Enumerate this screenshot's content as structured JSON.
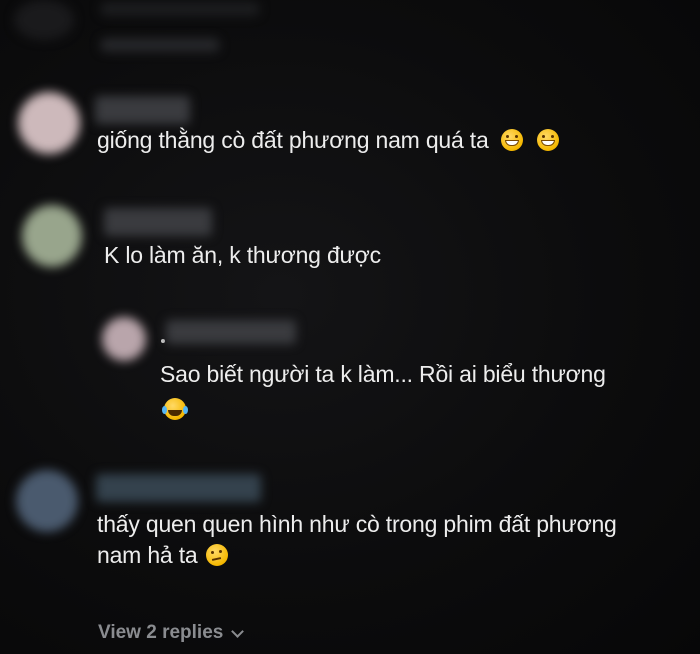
{
  "comments": [
    {
      "text": "giống thằng cò đất phương nam quá ta",
      "emojis": [
        "grinning-icon",
        "grinning-icon"
      ]
    },
    {
      "text": "K lo làm ăn, k thương được",
      "emojis": []
    },
    {
      "is_reply": true,
      "line1": "Sao biết người ta k làm... Rồi ai biểu thương",
      "emojis": [
        "joy-icon"
      ]
    },
    {
      "line1": "thấy quen quen hình như cò trong phim đất phương",
      "line2": "nam hả ta",
      "emojis": [
        "thinking-icon"
      ]
    }
  ],
  "view_replies_label": "View 2 replies",
  "colors": {
    "background": "#0b0b0c",
    "text": "#ededed",
    "muted": "#8a8c90"
  }
}
